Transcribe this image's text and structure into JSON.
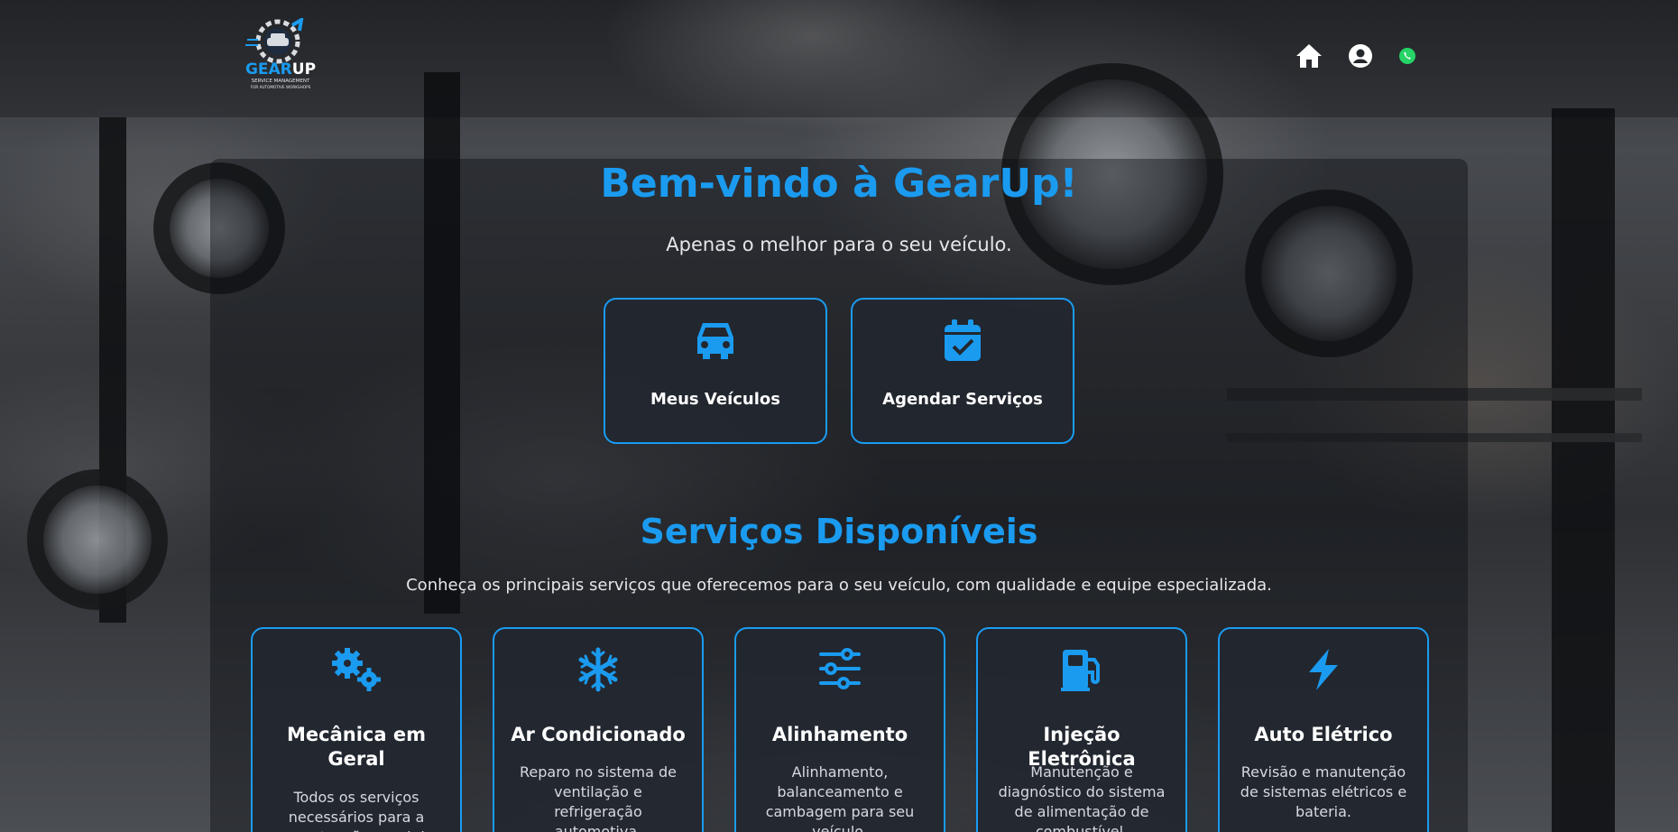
{
  "brand": {
    "name_part1": "GEAR",
    "name_part2": "UP",
    "tagline1": "SERVICE MANAGEMENT",
    "tagline2": "FOR AUTOMOTIVE WORKSHOPS"
  },
  "nav": {
    "icons": [
      "home-icon",
      "user-circle-icon",
      "whatsapp-icon"
    ]
  },
  "hero": {
    "title": "Bem-vindo à GearUp!",
    "subtitle": "Apenas o melhor para o seu veículo."
  },
  "actions": [
    {
      "label": "Meus Veículos",
      "icon": "car-icon"
    },
    {
      "label": "Agendar Serviços",
      "icon": "calendar-check-icon"
    }
  ],
  "services_section": {
    "title": "Serviços Disponíveis",
    "subtitle": "Conheça os principais serviços que oferecemos para o seu veículo, com qualidade e equipe especializada."
  },
  "services": [
    {
      "title": "Mecânica em Geral",
      "description": "Todos os serviços necessários para a manutenção geral do",
      "icon": "gears-icon"
    },
    {
      "title": "Ar Condicionado",
      "description": "Reparo no sistema de ventilação e refrigeração automotiva.",
      "icon": "snowflake-icon"
    },
    {
      "title": "Alinhamento",
      "description": "Alinhamento, balanceamento e cambagem para seu veículo.",
      "icon": "sliders-icon"
    },
    {
      "title": "Injeção Eletrônica",
      "description": "Manutenção e diagnóstico do sistema de alimentação de combustível.",
      "icon": "gas-pump-icon"
    },
    {
      "title": "Auto Elétrico",
      "description": "Revisão e manutenção de sistemas elétricos e bateria.",
      "icon": "bolt-icon"
    }
  ],
  "colors": {
    "accent": "#1a9bf0",
    "text": "#ffffff",
    "whatsapp": "#25d366"
  }
}
